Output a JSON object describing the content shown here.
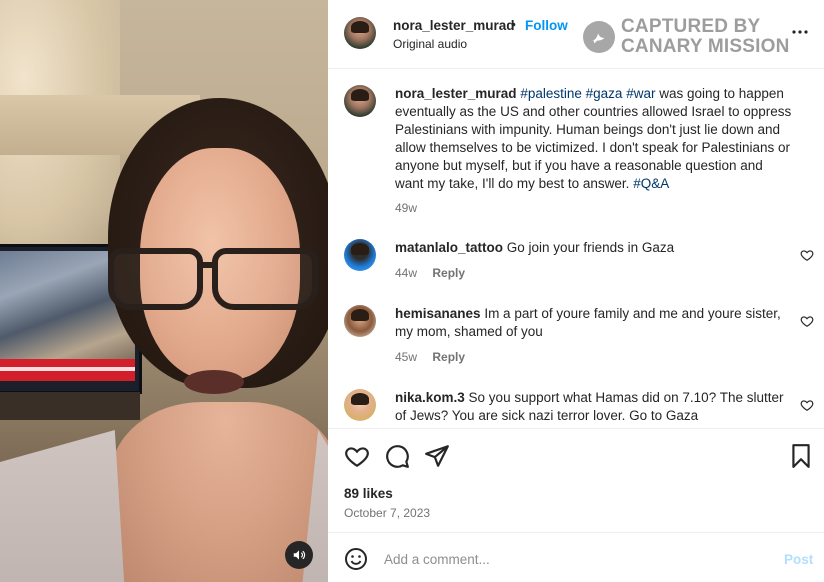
{
  "post": {
    "username": "nora_lester_murad",
    "follow_label": "Follow",
    "separator": "•",
    "audio": "Original audio",
    "caption_tags": [
      "#palestine",
      "#gaza",
      "#war"
    ],
    "caption_text": "was going to happen eventually as the US and other countries allowed Israel to oppress Palestinians with impunity. Human beings don't just lie down and allow themselves to be victimized. I don't speak for Palestinians or anyone but myself, but if you have a reasonable question and want my take, I'll do my best to answer.",
    "caption_end_tag": "#Q&A",
    "caption_time": "49w",
    "likes": "89 likes",
    "date": "October 7, 2023"
  },
  "watermark": {
    "line1": "CAPTURED BY",
    "line2": "CANARY MISSION"
  },
  "comments": [
    {
      "username": "matanlalo_tattoo",
      "text": "Go join your friends in Gaza",
      "time": "44w",
      "reply_label": "Reply"
    },
    {
      "username": "hemisananes",
      "text": "Im a part of youre family and me and youre sister, my mom, shamed of you",
      "time": "45w",
      "reply_label": "Reply"
    },
    {
      "username": "nika.kom.3",
      "text": "So you support what Hamas did on 7.10? The slutter of Jews? You are sick nazi terror lover. Go to Gaza",
      "time": "",
      "reply_label": ""
    }
  ],
  "add_comment": {
    "placeholder": "Add a comment...",
    "post_label": "Post"
  },
  "icons": {
    "like": "heart-icon",
    "comment": "comment-bubble-icon",
    "share": "paper-plane-icon",
    "save": "bookmark-icon",
    "more": "more-dots-icon",
    "emoji": "emoji-smile-icon",
    "sound": "speaker-icon",
    "watermark": "bird-logo-icon"
  },
  "colors": {
    "follow": "#0095f6",
    "hashtag": "#00376b",
    "muted": "#737373",
    "post_disabled": "#b2dffc"
  }
}
